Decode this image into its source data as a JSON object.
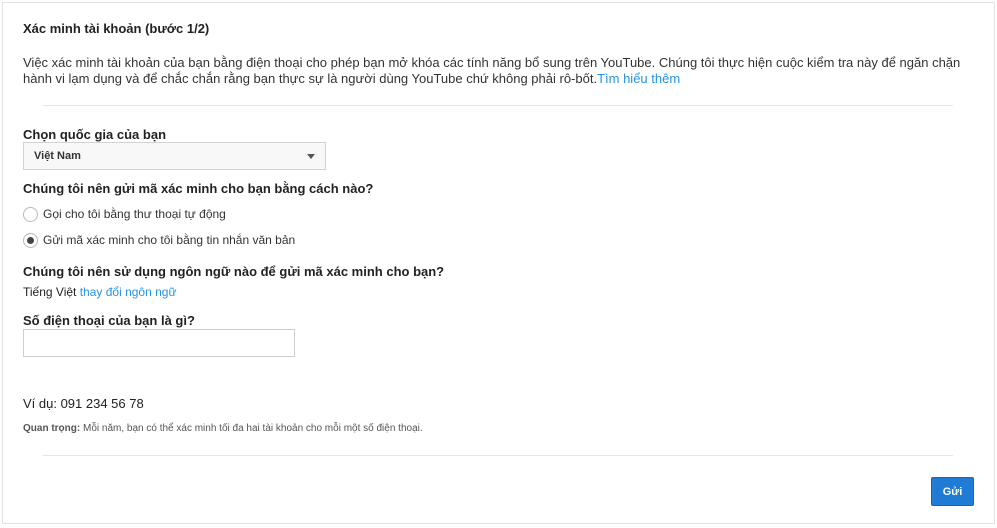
{
  "page": {
    "title": "Xác minh tài khoản (bước 1/2)",
    "description": "Việc xác minh tài khoản của bạn bằng điện thoại cho phép bạn mở khóa các tính năng bổ sung trên YouTube. Chúng tôi thực hiện cuộc kiểm tra này để ngăn chặn hành vi lạm dụng và để chắc chắn rằng bạn thực sự là người dùng YouTube chứ không phải rô-bốt.",
    "learn_more": "Tìm hiểu thêm"
  },
  "country": {
    "label": "Chọn quốc gia của bạn",
    "selected": "Việt Nam"
  },
  "method": {
    "question": "Chúng tôi nên gửi mã xác minh cho bạn bằng cách nào?",
    "options": [
      {
        "label": "Gọi cho tôi bằng thư thoại tự động",
        "checked": false
      },
      {
        "label": "Gửi mã xác minh cho tôi bằng tin nhắn văn bản",
        "checked": true
      }
    ]
  },
  "language": {
    "question": "Chúng tôi nên sử dụng ngôn ngữ nào để gửi mã xác minh cho bạn?",
    "current": "Tiếng Việt",
    "change_link": "thay đổi ngôn ngữ"
  },
  "phone": {
    "label": "Số điện thoại của bạn là gì?",
    "value": "",
    "placeholder": "",
    "example": "Ví dụ: 091 234 56 78",
    "note_strong": "Quan trọng:",
    "note_text": " Mỗi năm, bạn có thể xác minh tối đa hai tài khoản cho mỗi một số điện thoại."
  },
  "actions": {
    "submit_label": "Gửi",
    "submit_color": "#1f7bd4"
  },
  "colors": {
    "link": "#2793e6"
  }
}
